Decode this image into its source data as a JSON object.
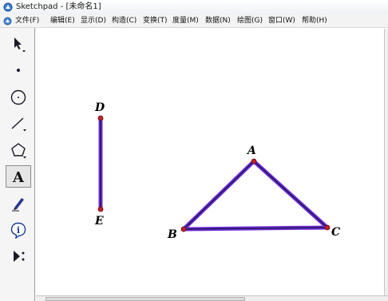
{
  "window": {
    "title": "Sketchpad - [未命名1]"
  },
  "menu": [
    {
      "label": "文件(F)"
    },
    {
      "label": "编辑(E)"
    },
    {
      "label": "显示(D)"
    },
    {
      "label": "构造(C)"
    },
    {
      "label": "变换(T)"
    },
    {
      "label": "度量(M)"
    },
    {
      "label": "数据(N)"
    },
    {
      "label": "绘图(G)"
    },
    {
      "label": "窗口(W)"
    },
    {
      "label": "帮助(H)"
    }
  ],
  "toolbar": {
    "tools": [
      {
        "icon": "arrow-select-icon"
      },
      {
        "icon": "point-tool-icon"
      },
      {
        "icon": "compass-circle-icon"
      },
      {
        "icon": "straightedge-icon"
      },
      {
        "icon": "polygon-icon"
      },
      {
        "icon": "text-tool-icon",
        "glyph": "A",
        "selected": true
      },
      {
        "icon": "marker-pen-icon"
      },
      {
        "icon": "information-icon",
        "glyph": "i"
      },
      {
        "icon": "custom-tool-icon"
      }
    ]
  },
  "sketch": {
    "point_color": "#c8202a",
    "segment_color": "#6f2bd9",
    "segment_core_color": "#1a1a4a",
    "points": [
      "D",
      "E",
      "A",
      "B",
      "C"
    ]
  }
}
